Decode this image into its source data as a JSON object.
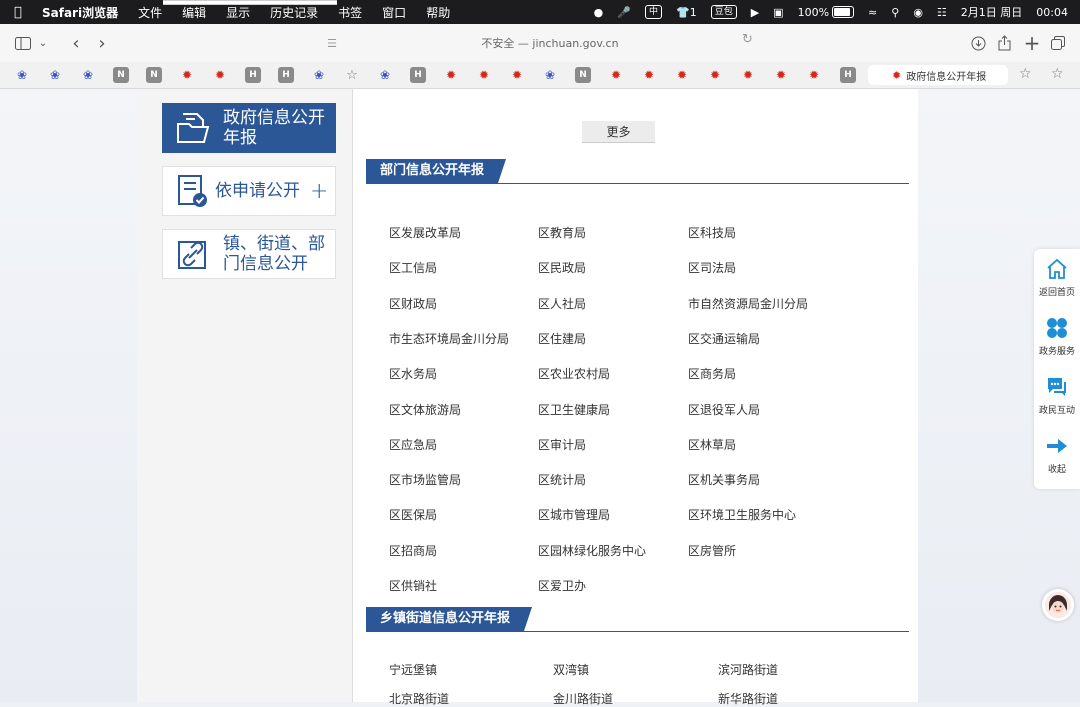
{
  "menubar": {
    "app": "Safari浏览器",
    "items": [
      "文件",
      "编辑",
      "显示",
      "历史记录",
      "书签",
      "窗口",
      "帮助"
    ],
    "status": {
      "input_method": "中",
      "shirt_count": "1",
      "bean_label": "豆包",
      "battery": "100%",
      "date": "2月1日 周日",
      "time": "00:04"
    }
  },
  "toolbar": {
    "address": "不安全 — jinchuan.gov.cn"
  },
  "favorites": {
    "gray_letters": [
      "N",
      "N",
      "H",
      "H",
      "H",
      "N",
      "H"
    ],
    "active_tab": "政府信息公开年报"
  },
  "left_nav": [
    {
      "label_lines": [
        "政府信息公开",
        "年报"
      ],
      "active": true
    },
    {
      "label_lines": [
        "依申请公开"
      ],
      "active": false,
      "suffix": "+"
    },
    {
      "label_lines": [
        "镇、街道、部",
        "门信息公开"
      ],
      "active": false
    }
  ],
  "more_button": "更多",
  "department_section": {
    "title": "部门信息公开年报",
    "items": [
      "区发展改革局",
      "区教育局",
      "区科技局",
      "区工信局",
      "区民政局",
      "区司法局",
      "区财政局",
      "区人社局",
      "市自然资源局金川分局",
      "市生态环境局金川分局",
      "区住建局",
      "区交通运输局",
      "区水务局",
      "区农业农村局",
      "区商务局",
      "区文体旅游局",
      "区卫生健康局",
      "区退役军人局",
      "区应急局",
      "区审计局",
      "区林草局",
      "区市场监管局",
      "区统计局",
      "区机关事务局",
      "区医保局",
      "区城市管理局",
      "区环境卫生服务中心",
      "区招商局",
      "区园林绿化服务中心",
      "区房管所",
      "区供销社",
      "区爱卫办"
    ]
  },
  "town_section": {
    "title": "乡镇街道信息公开年报",
    "items": [
      "宁远堡镇",
      "双湾镇",
      "滨河路街道",
      "北京路街道",
      "金川路街道",
      "新华路街道"
    ]
  },
  "float_bar": {
    "items": [
      "返回首页",
      "政务服务",
      "政民互动",
      "收起"
    ]
  },
  "colors": {
    "primary": "#2b5797",
    "float_icon": "#1e8fd6"
  }
}
